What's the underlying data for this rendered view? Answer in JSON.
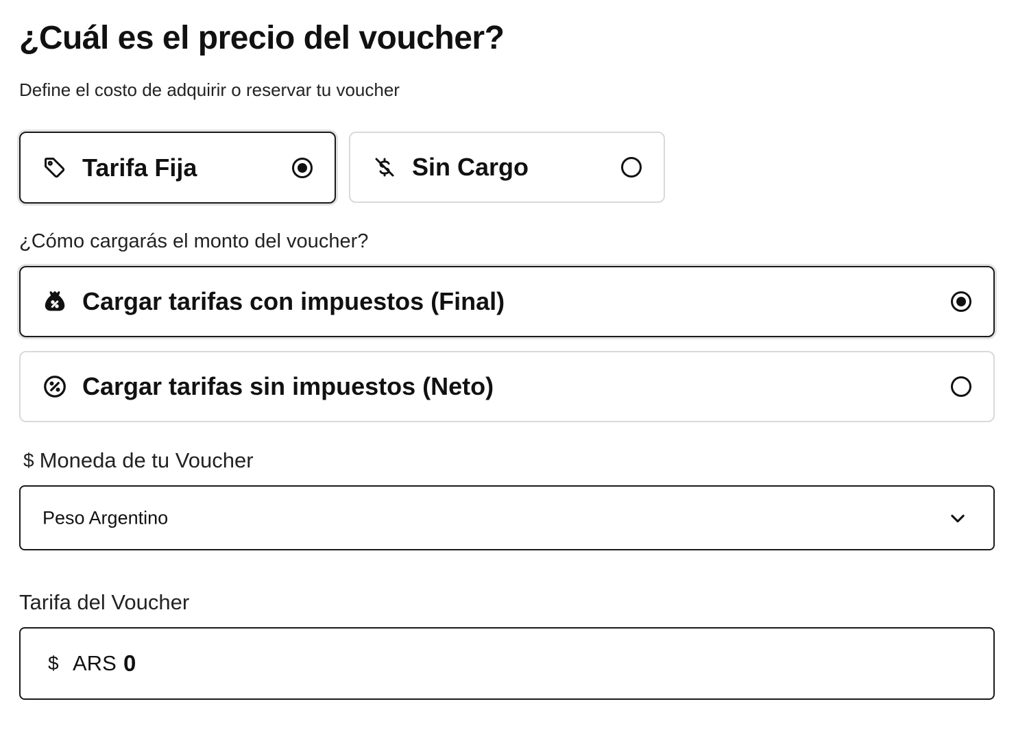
{
  "header": {
    "title": "¿Cuál es el precio del voucher?",
    "subtitle": "Define el costo de adquirir o reservar tu voucher"
  },
  "pricing_type": {
    "options": [
      {
        "label": "Tarifa Fija",
        "icon": "tag-icon",
        "selected": true
      },
      {
        "label": "Sin Cargo",
        "icon": "no-dollar-icon",
        "selected": false
      }
    ]
  },
  "tax_mode": {
    "question": "¿Cómo cargarás el monto del voucher?",
    "options": [
      {
        "label": "Cargar tarifas con impuestos (Final)",
        "icon": "money-bag-percent-icon",
        "selected": true
      },
      {
        "label": "Cargar tarifas sin impuestos (Neto)",
        "icon": "percent-circle-icon",
        "selected": false
      }
    ]
  },
  "currency": {
    "label_symbol": "$",
    "label": "Moneda de tu Voucher",
    "selected": "Peso Argentino"
  },
  "price": {
    "label": "Tarifa del Voucher",
    "symbol": "$",
    "currency_code": "ARS",
    "value": "0"
  }
}
